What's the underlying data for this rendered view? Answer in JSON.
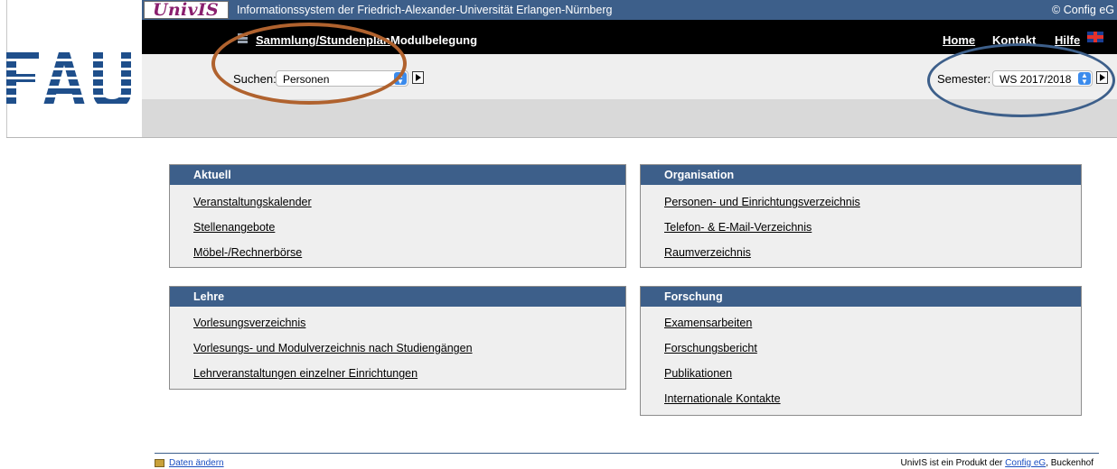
{
  "header": {
    "logo_text": "UnivIS",
    "title": "Informationssystem der Friedrich-Alexander-Universität Erlangen-Nürnberg",
    "copyright": "© Config eG",
    "fau_logo": "FAU"
  },
  "nav": {
    "icon": "table-icon",
    "sammlung": "Sammlung/Stundenplan",
    "modul": "Modulbelegung",
    "home": "Home",
    "kontakt": "Kontakt",
    "hilfe": "Hilfe",
    "flag_icon": "uk-flag-icon"
  },
  "search": {
    "label": "Suchen:",
    "value": "Personen"
  },
  "semester": {
    "label": "Semester:",
    "value": "WS 2017/2018"
  },
  "sections": {
    "aktuell": {
      "title": "Aktuell",
      "items": [
        "Veranstaltungskalender",
        "Stellenangebote",
        "Möbel-/Rechnerbörse"
      ]
    },
    "organisation": {
      "title": "Organisation",
      "items": [
        "Personen- und Einrichtungsverzeichnis",
        "Telefon- & E-Mail-Verzeichnis",
        "Raumverzeichnis"
      ]
    },
    "lehre": {
      "title": "Lehre",
      "items": [
        "Vorlesungsverzeichnis",
        "Vorlesungs- und Modulverzeichnis nach Studiengängen",
        "Lehrveranstaltungen einzelner Einrichtungen"
      ]
    },
    "forschung": {
      "title": "Forschung",
      "items": [
        "Examensarbeiten",
        "Forschungsbericht",
        "Publikationen",
        "Internationale Kontakte"
      ]
    }
  },
  "footer": {
    "left": "Daten ändern",
    "right_prefix": "UnivIS ist ein Produkt der",
    "right_link": "Config eG",
    "right_suffix": ", Buckenhof"
  },
  "colors": {
    "header_blue": "#3d5f8a",
    "annotation_brown": "#b0622e",
    "annotation_blue": "#3d5f8a"
  }
}
